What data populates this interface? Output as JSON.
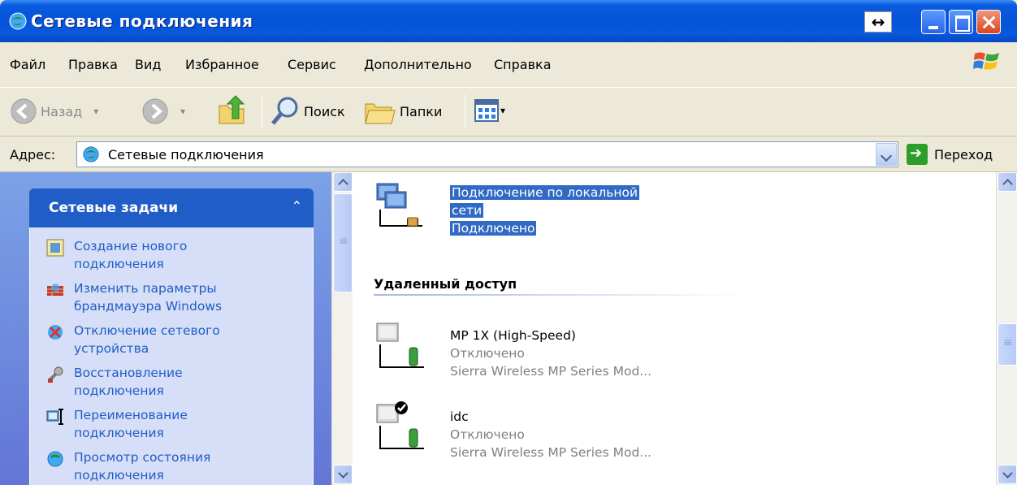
{
  "window": {
    "title": "Сетевые подключения",
    "resize_glyph": "↔"
  },
  "menu": [
    "Файл",
    "Правка",
    "Вид",
    "Избранное",
    "Сервис",
    "Дополнительно",
    "Справка"
  ],
  "toolbar": {
    "back": "Назад",
    "search": "Поиск",
    "folders": "Папки"
  },
  "address": {
    "label": "Адрес:",
    "value": "Сетевые подключения",
    "go": "Переход"
  },
  "sidebar": {
    "header": "Сетевые задачи",
    "collapse_glyph": "⌃",
    "items": [
      {
        "label": "Создание нового подключения",
        "icon": "new-connection-icon"
      },
      {
        "label": "Изменить параметры брандмауэра Windows",
        "icon": "firewall-icon"
      },
      {
        "label": "Отключение сетевого устройства",
        "icon": "disable-device-icon"
      },
      {
        "label": "Восстановление подключения",
        "icon": "repair-icon"
      },
      {
        "label": "Переименование подключения",
        "icon": "rename-icon"
      },
      {
        "label": "Просмотр состояния подключения",
        "icon": "status-icon"
      }
    ]
  },
  "connections": {
    "lan": {
      "name_line1": "Подключение по локальной",
      "name_line2": "сети",
      "status": "Подключено"
    },
    "group_header": "Удаленный доступ",
    "dialup": [
      {
        "name": "MP 1X (High-Speed)",
        "status": "Отключено",
        "device": "Sierra Wireless MP Series Mod..."
      },
      {
        "name": "idc",
        "status": "Отключено",
        "device": "Sierra Wireless MP Series Mod..."
      }
    ]
  }
}
